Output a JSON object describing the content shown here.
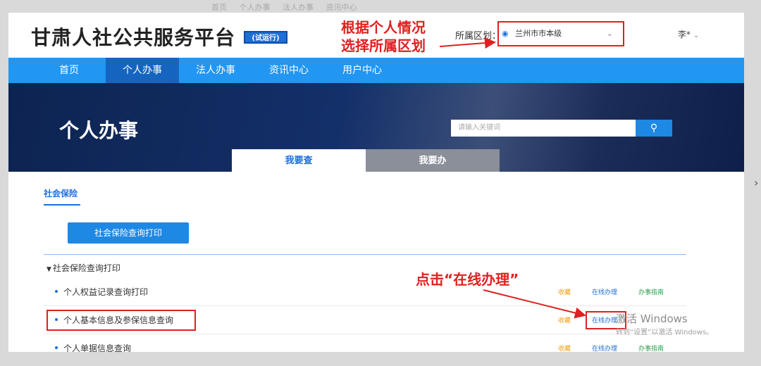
{
  "browser": {
    "faded_top_items": [
      "首页",
      "个人办事",
      "法人办事",
      "资讯中心"
    ],
    "right_arrow": "›"
  },
  "header": {
    "site_title": "甘肃人社公共服务平台",
    "trial_badge": "(试运行)",
    "annotation_region": [
      "根据个人情况",
      "选择所属区划"
    ],
    "region_label": "所属区划：",
    "region_value": "兰州市市本级",
    "user_name": "李*"
  },
  "nav": {
    "items": [
      {
        "label": "首页",
        "active": false
      },
      {
        "label": "个人办事",
        "active": true
      },
      {
        "label": "法人办事",
        "active": false
      },
      {
        "label": "资讯中心",
        "active": false
      },
      {
        "label": "用户中心",
        "active": false
      }
    ]
  },
  "banner": {
    "title": "个人办事",
    "search_placeholder": "请输入关键词",
    "tabs": [
      {
        "label": "我要查",
        "active": true
      },
      {
        "label": "我要办",
        "active": false
      }
    ]
  },
  "content": {
    "section_tab": "社会保险",
    "main_button": "社会保险查询打印",
    "group_title": "社会保险查询打印",
    "annotation_click": "点击“在线办理”",
    "rows": [
      {
        "name": "个人权益记录查询打印",
        "fav": "收藏",
        "online": "在线办理",
        "guide": "办事指南"
      },
      {
        "name": "个人基本信息及参保信息查询",
        "fav": "收藏",
        "online": "在线办理",
        "guide": ""
      },
      {
        "name": "个人单据信息查询",
        "fav": "收藏",
        "online": "在线办理",
        "guide": "办事指南"
      }
    ]
  },
  "watermark": {
    "title": "激活 Windows",
    "sub": "转到“设置”以激活 Windows。"
  },
  "colors": {
    "nav_bg": "#2196f3",
    "nav_active": "#1565c0",
    "accent_blue": "#1e88e5",
    "annotation_red": "#e02020",
    "fav_orange": "#f39c12",
    "guide_green": "#2e9e4e"
  }
}
